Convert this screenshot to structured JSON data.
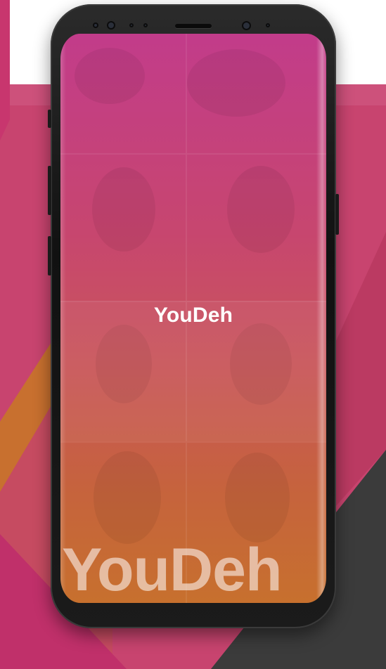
{
  "app": {
    "title": "YouDeh",
    "watermark_brand": "YouDeh"
  },
  "colors": {
    "brand_pink": "#c8366e",
    "brand_orange": "#c7702e",
    "background_dark": "#3b3b3b"
  },
  "icons": {
    "front_camera": "front-camera-icon",
    "speaker": "earpiece-speaker-icon",
    "sensor": "proximity-sensor-icon"
  }
}
